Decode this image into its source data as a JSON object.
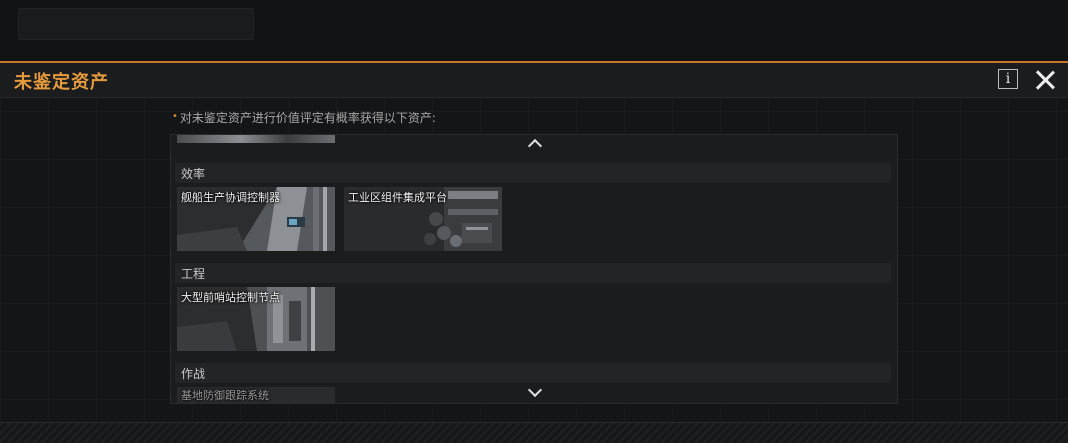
{
  "background": {
    "ghost_title": "",
    "ghost_subtitle": ""
  },
  "modal": {
    "title": "未鉴定资产",
    "info_label": "i",
    "description": "对未鉴定资产进行价值评定有概率获得以下资产:"
  },
  "categories": [
    {
      "name": "效率",
      "items": [
        "舰船生产协调控制器",
        "工业区组件集成平台"
      ]
    },
    {
      "name": "工程",
      "items": [
        "大型前哨站控制节点"
      ]
    },
    {
      "name": "作战",
      "items": [
        "基地防御跟踪系统"
      ]
    }
  ],
  "colors": {
    "accent": "#e59a3c",
    "panel": "#1b1c1d",
    "background": "#141516"
  }
}
